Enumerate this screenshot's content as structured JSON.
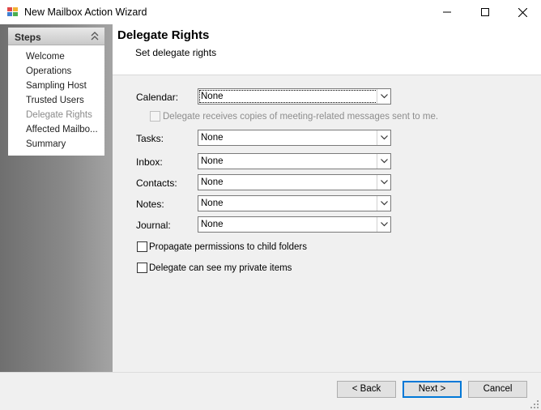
{
  "window": {
    "title": "New Mailbox Action Wizard",
    "icon": "app-wizard-icon"
  },
  "sidebar": {
    "title": "Steps",
    "items": [
      {
        "label": "Welcome",
        "current": false
      },
      {
        "label": "Operations",
        "current": false
      },
      {
        "label": "Sampling Host",
        "current": false
      },
      {
        "label": "Trusted Users",
        "current": false
      },
      {
        "label": "Delegate Rights",
        "current": true
      },
      {
        "label": "Affected Mailbo...",
        "current": false
      },
      {
        "label": "Summary",
        "current": false
      }
    ]
  },
  "header": {
    "title": "Delegate Rights",
    "subtitle": "Set delegate rights"
  },
  "form": {
    "calendar": {
      "label": "Calendar:",
      "value": "None"
    },
    "meeting_copies": {
      "label": "Delegate receives copies of meeting-related messages sent to me.",
      "checked": false,
      "enabled": false
    },
    "tasks": {
      "label": "Tasks:",
      "value": "None"
    },
    "inbox": {
      "label": "Inbox:",
      "value": "None"
    },
    "contacts": {
      "label": "Contacts:",
      "value": "None"
    },
    "notes": {
      "label": "Notes:",
      "value": "None"
    },
    "journal": {
      "label": "Journal:",
      "value": "None"
    },
    "propagate": {
      "label": "Propagate permissions to child folders",
      "checked": false
    },
    "private_items": {
      "label": "Delegate can see my private items",
      "checked": false
    }
  },
  "footer": {
    "back_label": "< Back",
    "next_label": "Next >",
    "cancel_label": "Cancel"
  },
  "colors": {
    "accent": "#0078d7",
    "disabled_text": "#8d8d8d"
  }
}
